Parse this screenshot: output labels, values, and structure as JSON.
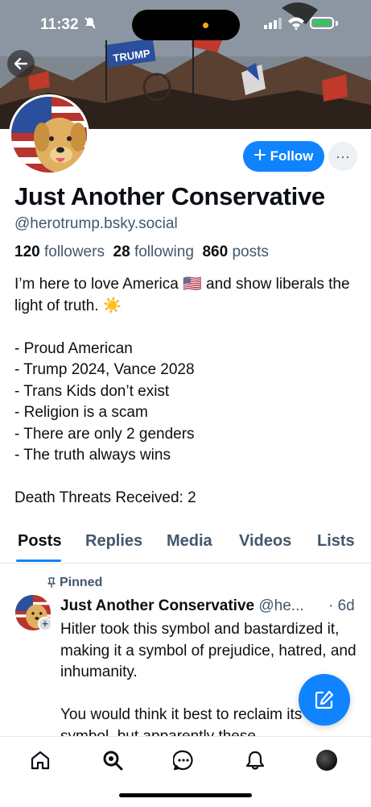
{
  "status_bar": {
    "time": "11:32"
  },
  "profile": {
    "display_name": "Just Another Conservative",
    "handle": "@herotrump.bsky.social",
    "followers_count": "120",
    "followers_label": "followers",
    "following_count": "28",
    "following_label": "following",
    "posts_count": "860",
    "posts_label": "posts",
    "bio": "I’m here to love America 🇺🇸 and show liberals the light of truth. ☀️\n\n- Proud American\n- Trump 2024, Vance 2028\n- Trans Kids don’t exist\n- Religion is a scam\n- There are only 2 genders\n- The truth always wins\n\nDeath Threats Received: 2",
    "banner_flag_text": "TRUMP"
  },
  "actions": {
    "follow_label": "Follow",
    "more_label": "···"
  },
  "tabs": [
    "Posts",
    "Replies",
    "Media",
    "Videos",
    "Lists"
  ],
  "active_tab": "Posts",
  "pinned_post": {
    "pinned_label": "Pinned",
    "author": "Just Another Conservative",
    "handle": "@he...",
    "time": "· 6d",
    "text": "Hitler took this symbol and bastardized it, making it a symbol of prejudice, hatred, and inhumanity.\n\nYou would think it best to reclaim its holy symbol, but apparently these"
  },
  "bottom_nav": [
    "home-icon",
    "search-icon",
    "chat-icon",
    "bell-icon",
    "profile-avatar"
  ],
  "colors": {
    "accent": "#1083fe",
    "muted_text": "#42576c",
    "text": "#0b0f14"
  }
}
